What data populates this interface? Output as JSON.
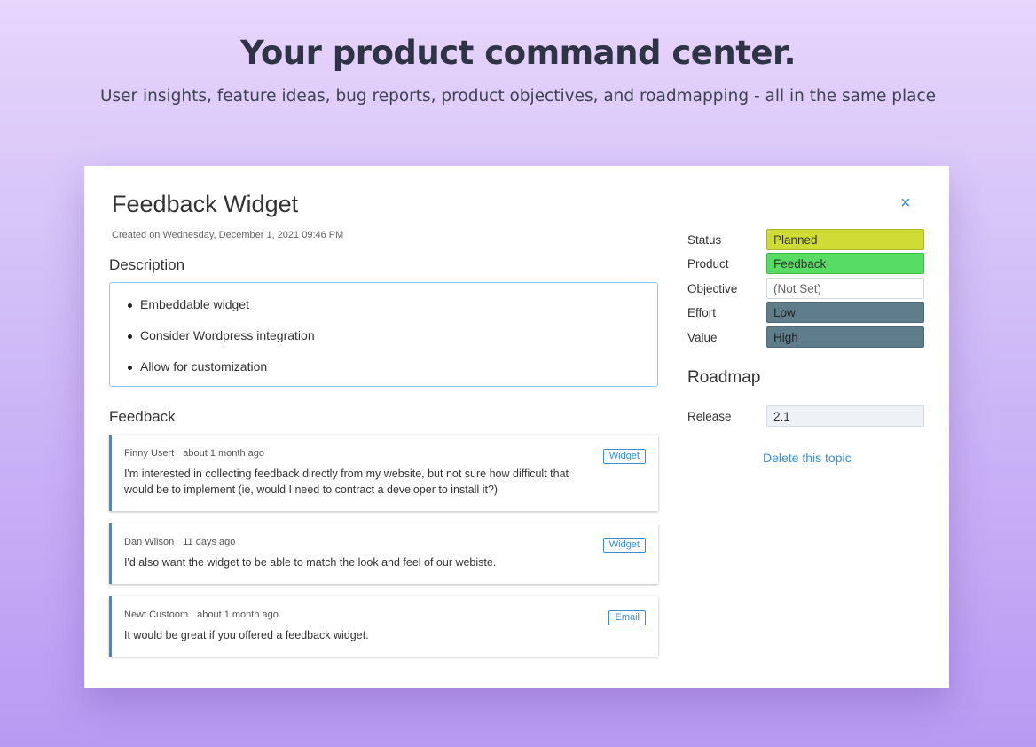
{
  "hero": {
    "title": "Your product command center.",
    "subtitle": "User insights, feature ideas, bug reports, product objectives, and roadmapping - all in the same place"
  },
  "card": {
    "title": "Feedback Widget",
    "close_icon": "×",
    "created": "Created on Wednesday, December 1, 2021 09:46 PM",
    "description_heading": "Description",
    "description_items": [
      "Embeddable widget",
      "Consider Wordpress integration",
      "Allow for customization"
    ],
    "feedback_heading": "Feedback",
    "feedback": [
      {
        "author": "Finny Usert",
        "time": "about 1 month ago",
        "text": "I'm interested in collecting feedback directly from my website, but not sure how difficult that would be to implement (ie, would I need to contract a developer to install it?)",
        "tag": "Widget"
      },
      {
        "author": "Dan Wilson",
        "time": "11 days ago",
        "text": "I'd also want the widget to be able to match the look and feel of our webiste.",
        "tag": "Widget"
      },
      {
        "author": "Newt Custoom",
        "time": "about 1 month ago",
        "text": "It would be great if you offered a feedback widget.",
        "tag": "Email"
      }
    ],
    "properties": {
      "status_label": "Status",
      "status_value": "Planned",
      "product_label": "Product",
      "product_value": "Feedback",
      "objective_label": "Objective",
      "objective_value": "(Not Set)",
      "effort_label": "Effort",
      "effort_value": "Low",
      "value_label": "Value",
      "value_value": "High"
    },
    "roadmap_heading": "Roadmap",
    "release_label": "Release",
    "release_value": "2.1",
    "delete_link": "Delete this topic"
  },
  "colors": {
    "accent": "#3a8fd0",
    "status_planned": "#cfdc36",
    "product_feedback": "#57dd63",
    "effort_value_bg": "#607d8b",
    "release_bg": "#eef1f5"
  }
}
